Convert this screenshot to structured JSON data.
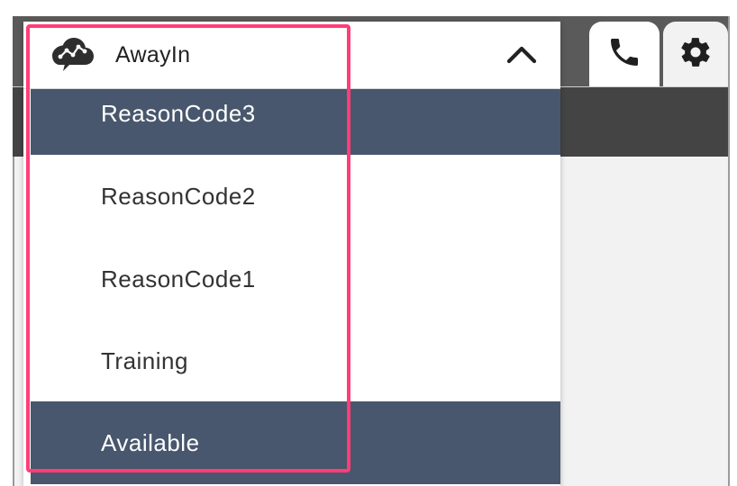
{
  "status_dropdown": {
    "current_status": "AwayIn",
    "options": [
      {
        "label": "ReasonCode3",
        "selected": true
      },
      {
        "label": "ReasonCode2",
        "selected": false
      },
      {
        "label": "ReasonCode1",
        "selected": false
      },
      {
        "label": "Training",
        "selected": false
      },
      {
        "label": "Available",
        "selected": true
      }
    ]
  },
  "tabs": {
    "phone_icon": "phone-icon",
    "settings_icon": "gear-icon"
  },
  "colors": {
    "selected_row": "#48576d",
    "highlight": "#ff3d78"
  }
}
